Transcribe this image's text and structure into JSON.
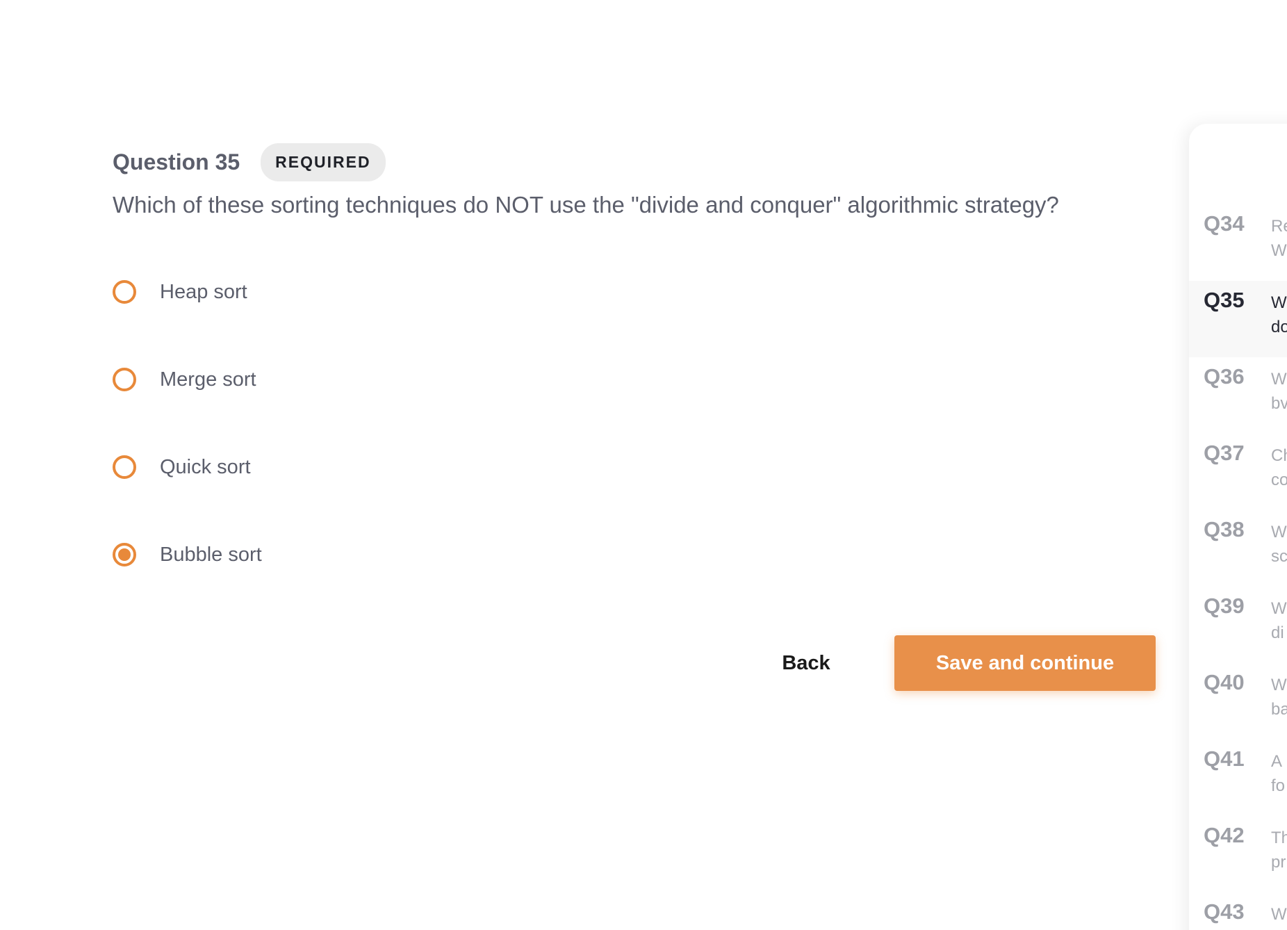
{
  "question": {
    "number_label": "Question 35",
    "badge": "REQUIRED",
    "text": "Which of these sorting techniques do NOT use the \"divide and conquer\" algorithmic strategy?"
  },
  "options": [
    {
      "label": "Heap sort",
      "selected": false
    },
    {
      "label": "Merge sort",
      "selected": false
    },
    {
      "label": "Quick sort",
      "selected": false
    },
    {
      "label": "Bubble sort",
      "selected": true
    }
  ],
  "actions": {
    "back_label": "Back",
    "save_label": "Save and continue"
  },
  "navigator": {
    "items": [
      {
        "q": "Q34",
        "line1": "Re",
        "line2": "W",
        "active": false
      },
      {
        "q": "Q35",
        "line1": "W",
        "line2": "do",
        "active": true
      },
      {
        "q": "Q36",
        "line1": "W",
        "line2": "bv",
        "active": false
      },
      {
        "q": "Q37",
        "line1": "Ch",
        "line2": "co",
        "active": false
      },
      {
        "q": "Q38",
        "line1": "W",
        "line2": "sc",
        "active": false
      },
      {
        "q": "Q39",
        "line1": "W",
        "line2": "di",
        "active": false
      },
      {
        "q": "Q40",
        "line1": "W",
        "line2": "ba",
        "active": false
      },
      {
        "q": "Q41",
        "line1": "A",
        "line2": "fo",
        "active": false
      },
      {
        "q": "Q42",
        "line1": "Th",
        "line2": "pr",
        "active": false
      },
      {
        "q": "Q43",
        "line1": "W",
        "line2": "",
        "active": false
      }
    ]
  },
  "colors": {
    "accent": "#e8893a",
    "button_bg": "#e8904a",
    "text_muted": "#5b5e6b"
  }
}
